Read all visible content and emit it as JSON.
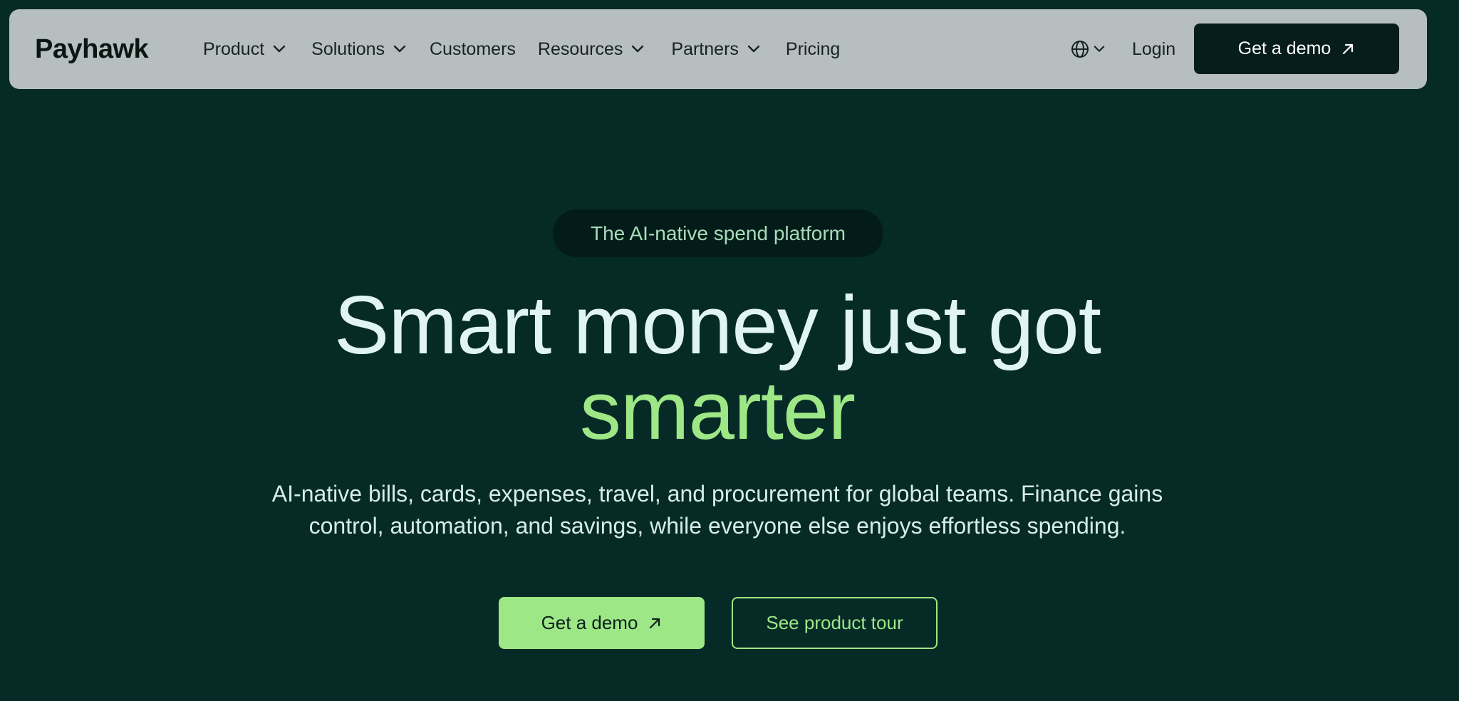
{
  "brand": {
    "name": "Payhawk"
  },
  "nav": {
    "items": [
      {
        "label": "Product",
        "has_dropdown": true
      },
      {
        "label": "Solutions",
        "has_dropdown": true
      },
      {
        "label": "Customers",
        "has_dropdown": false
      },
      {
        "label": "Resources",
        "has_dropdown": true
      },
      {
        "label": "Partners",
        "has_dropdown": true
      },
      {
        "label": "Pricing",
        "has_dropdown": false
      }
    ],
    "language_icon": "globe-icon",
    "login_label": "Login",
    "cta_label": "Get a demo"
  },
  "hero": {
    "eyebrow": "The AI-native spend platform",
    "headline_line1": "Smart money just got",
    "headline_line2": "smarter",
    "subtitle_line1": "AI-native bills, cards, expenses, travel, and procurement for global teams. Finance gains",
    "subtitle_line2": "control, automation, and savings, while everyone else enjoys effortless spending.",
    "primary_cta": "Get a demo",
    "secondary_cta": "See product tour"
  },
  "colors": {
    "background": "#062a26",
    "navbar": "#b7bebf",
    "accent_green": "#9ee786",
    "dark_button": "#071d1b",
    "headline_text": "#dff4f3"
  }
}
